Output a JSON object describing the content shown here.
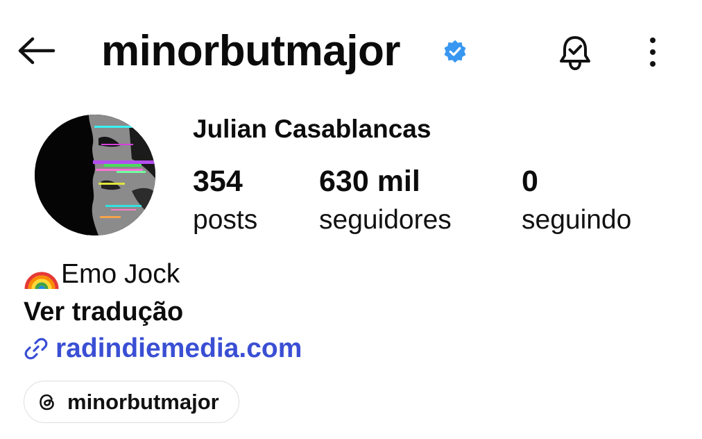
{
  "header": {
    "back_icon": "arrow-left-icon",
    "username": "minorbutmajor",
    "verified_icon": "verified-badge-icon",
    "verified_color": "#3897f0",
    "notifications_icon": "bell-check-icon",
    "more_icon": "more-vertical-icon"
  },
  "profile": {
    "full_name": "Julian Casablancas",
    "stats": [
      {
        "value": "354",
        "label": "posts"
      },
      {
        "value": "630 mil",
        "label": "seguidores"
      },
      {
        "value": "0",
        "label": "seguindo"
      }
    ]
  },
  "bio": {
    "emoji_icon": "rainbow-emoji",
    "text": "Emo Jock",
    "translate_label": "Ver tradução",
    "link_icon": "link-icon",
    "link_text": "radindiemedia.com",
    "link_color": "#3a4fd4"
  },
  "threads": {
    "icon": "threads-icon",
    "label": "minorbutmajor"
  }
}
